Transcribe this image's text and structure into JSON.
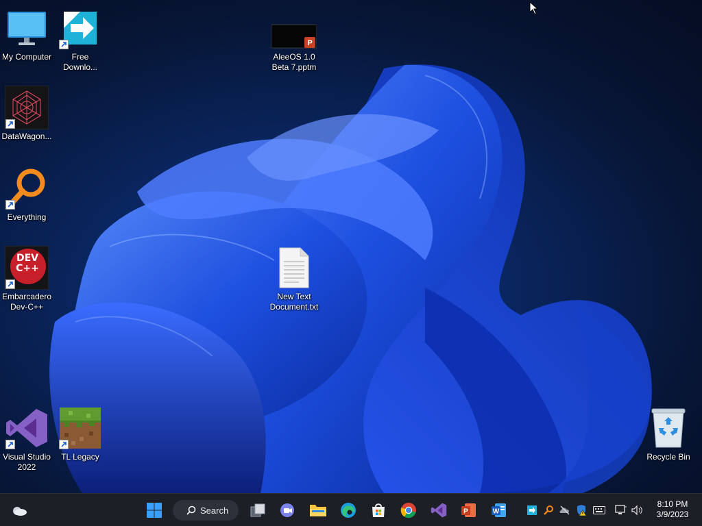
{
  "desktop": {
    "icons": [
      {
        "label": "My Computer",
        "icon": "monitor-icon"
      },
      {
        "label": "Free Downlo...",
        "icon": "download-arrow-icon"
      },
      {
        "label": "AleeOS 1.0 Beta 7.pptm",
        "icon": "powerpoint-file-icon"
      },
      {
        "label": "DataWagon...",
        "icon": "datawagon-icon"
      },
      {
        "label": "Everything",
        "icon": "magnifier-icon"
      },
      {
        "label": "Embarcadero Dev-C++",
        "icon": "devcpp-icon",
        "badge": "DEV C++"
      },
      {
        "label": "New Text Document.txt",
        "icon": "text-file-icon"
      },
      {
        "label": "Visual Studio 2022",
        "icon": "visual-studio-icon"
      },
      {
        "label": "TL Legacy",
        "icon": "grass-block-icon"
      },
      {
        "label": "Recycle Bin",
        "icon": "recycle-bin-icon"
      }
    ]
  },
  "taskbar": {
    "widgets_icon": "weather-icon",
    "search_label": "Search",
    "apps": [
      {
        "name": "start-button",
        "icon": "windows-logo-icon"
      },
      {
        "name": "task-view",
        "icon": "task-view-icon"
      },
      {
        "name": "teams",
        "icon": "video-chat-icon"
      },
      {
        "name": "file-explorer",
        "icon": "folder-icon"
      },
      {
        "name": "edge",
        "icon": "edge-icon"
      },
      {
        "name": "store",
        "icon": "store-icon"
      },
      {
        "name": "chrome",
        "icon": "chrome-icon"
      },
      {
        "name": "visual-studio",
        "icon": "visual-studio-icon"
      },
      {
        "name": "powerpoint",
        "icon": "powerpoint-icon"
      },
      {
        "name": "word",
        "icon": "word-icon"
      }
    ],
    "tray": [
      {
        "icon": "download-manager-tray-icon"
      },
      {
        "icon": "everything-tray-icon"
      },
      {
        "icon": "onedrive-offline-icon"
      },
      {
        "icon": "security-warning-icon"
      },
      {
        "icon": "keyboard-icon"
      },
      {
        "icon": "network-icon"
      },
      {
        "icon": "volume-icon"
      }
    ],
    "clock": {
      "time": "8:10 PM",
      "date": "3/9/2023"
    }
  },
  "colors": {
    "accent": "#1e6bff",
    "taskbar": "#1c1f26",
    "wallpaper_dark": "#050d22"
  }
}
